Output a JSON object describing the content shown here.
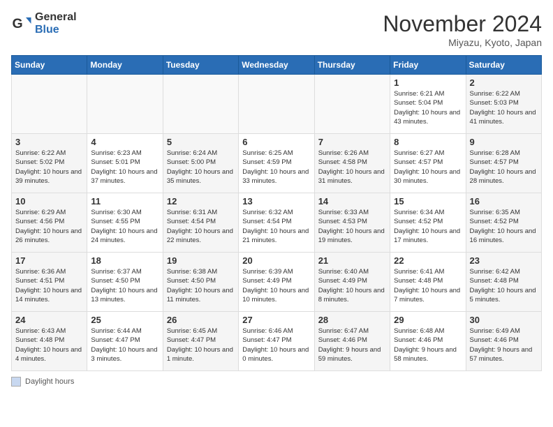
{
  "logo": {
    "general": "General",
    "blue": "Blue"
  },
  "title": "November 2024",
  "subtitle": "Miyazu, Kyoto, Japan",
  "days_of_week": [
    "Sunday",
    "Monday",
    "Tuesday",
    "Wednesday",
    "Thursday",
    "Friday",
    "Saturday"
  ],
  "legend_label": "Daylight hours",
  "weeks": [
    [
      {
        "day": "",
        "info": ""
      },
      {
        "day": "",
        "info": ""
      },
      {
        "day": "",
        "info": ""
      },
      {
        "day": "",
        "info": ""
      },
      {
        "day": "",
        "info": ""
      },
      {
        "day": "1",
        "info": "Sunrise: 6:21 AM\nSunset: 5:04 PM\nDaylight: 10 hours and 43 minutes."
      },
      {
        "day": "2",
        "info": "Sunrise: 6:22 AM\nSunset: 5:03 PM\nDaylight: 10 hours and 41 minutes."
      }
    ],
    [
      {
        "day": "3",
        "info": "Sunrise: 6:22 AM\nSunset: 5:02 PM\nDaylight: 10 hours and 39 minutes."
      },
      {
        "day": "4",
        "info": "Sunrise: 6:23 AM\nSunset: 5:01 PM\nDaylight: 10 hours and 37 minutes."
      },
      {
        "day": "5",
        "info": "Sunrise: 6:24 AM\nSunset: 5:00 PM\nDaylight: 10 hours and 35 minutes."
      },
      {
        "day": "6",
        "info": "Sunrise: 6:25 AM\nSunset: 4:59 PM\nDaylight: 10 hours and 33 minutes."
      },
      {
        "day": "7",
        "info": "Sunrise: 6:26 AM\nSunset: 4:58 PM\nDaylight: 10 hours and 31 minutes."
      },
      {
        "day": "8",
        "info": "Sunrise: 6:27 AM\nSunset: 4:57 PM\nDaylight: 10 hours and 30 minutes."
      },
      {
        "day": "9",
        "info": "Sunrise: 6:28 AM\nSunset: 4:57 PM\nDaylight: 10 hours and 28 minutes."
      }
    ],
    [
      {
        "day": "10",
        "info": "Sunrise: 6:29 AM\nSunset: 4:56 PM\nDaylight: 10 hours and 26 minutes."
      },
      {
        "day": "11",
        "info": "Sunrise: 6:30 AM\nSunset: 4:55 PM\nDaylight: 10 hours and 24 minutes."
      },
      {
        "day": "12",
        "info": "Sunrise: 6:31 AM\nSunset: 4:54 PM\nDaylight: 10 hours and 22 minutes."
      },
      {
        "day": "13",
        "info": "Sunrise: 6:32 AM\nSunset: 4:54 PM\nDaylight: 10 hours and 21 minutes."
      },
      {
        "day": "14",
        "info": "Sunrise: 6:33 AM\nSunset: 4:53 PM\nDaylight: 10 hours and 19 minutes."
      },
      {
        "day": "15",
        "info": "Sunrise: 6:34 AM\nSunset: 4:52 PM\nDaylight: 10 hours and 17 minutes."
      },
      {
        "day": "16",
        "info": "Sunrise: 6:35 AM\nSunset: 4:52 PM\nDaylight: 10 hours and 16 minutes."
      }
    ],
    [
      {
        "day": "17",
        "info": "Sunrise: 6:36 AM\nSunset: 4:51 PM\nDaylight: 10 hours and 14 minutes."
      },
      {
        "day": "18",
        "info": "Sunrise: 6:37 AM\nSunset: 4:50 PM\nDaylight: 10 hours and 13 minutes."
      },
      {
        "day": "19",
        "info": "Sunrise: 6:38 AM\nSunset: 4:50 PM\nDaylight: 10 hours and 11 minutes."
      },
      {
        "day": "20",
        "info": "Sunrise: 6:39 AM\nSunset: 4:49 PM\nDaylight: 10 hours and 10 minutes."
      },
      {
        "day": "21",
        "info": "Sunrise: 6:40 AM\nSunset: 4:49 PM\nDaylight: 10 hours and 8 minutes."
      },
      {
        "day": "22",
        "info": "Sunrise: 6:41 AM\nSunset: 4:48 PM\nDaylight: 10 hours and 7 minutes."
      },
      {
        "day": "23",
        "info": "Sunrise: 6:42 AM\nSunset: 4:48 PM\nDaylight: 10 hours and 5 minutes."
      }
    ],
    [
      {
        "day": "24",
        "info": "Sunrise: 6:43 AM\nSunset: 4:48 PM\nDaylight: 10 hours and 4 minutes."
      },
      {
        "day": "25",
        "info": "Sunrise: 6:44 AM\nSunset: 4:47 PM\nDaylight: 10 hours and 3 minutes."
      },
      {
        "day": "26",
        "info": "Sunrise: 6:45 AM\nSunset: 4:47 PM\nDaylight: 10 hours and 1 minute."
      },
      {
        "day": "27",
        "info": "Sunrise: 6:46 AM\nSunset: 4:47 PM\nDaylight: 10 hours and 0 minutes."
      },
      {
        "day": "28",
        "info": "Sunrise: 6:47 AM\nSunset: 4:46 PM\nDaylight: 9 hours and 59 minutes."
      },
      {
        "day": "29",
        "info": "Sunrise: 6:48 AM\nSunset: 4:46 PM\nDaylight: 9 hours and 58 minutes."
      },
      {
        "day": "30",
        "info": "Sunrise: 6:49 AM\nSunset: 4:46 PM\nDaylight: 9 hours and 57 minutes."
      }
    ]
  ]
}
